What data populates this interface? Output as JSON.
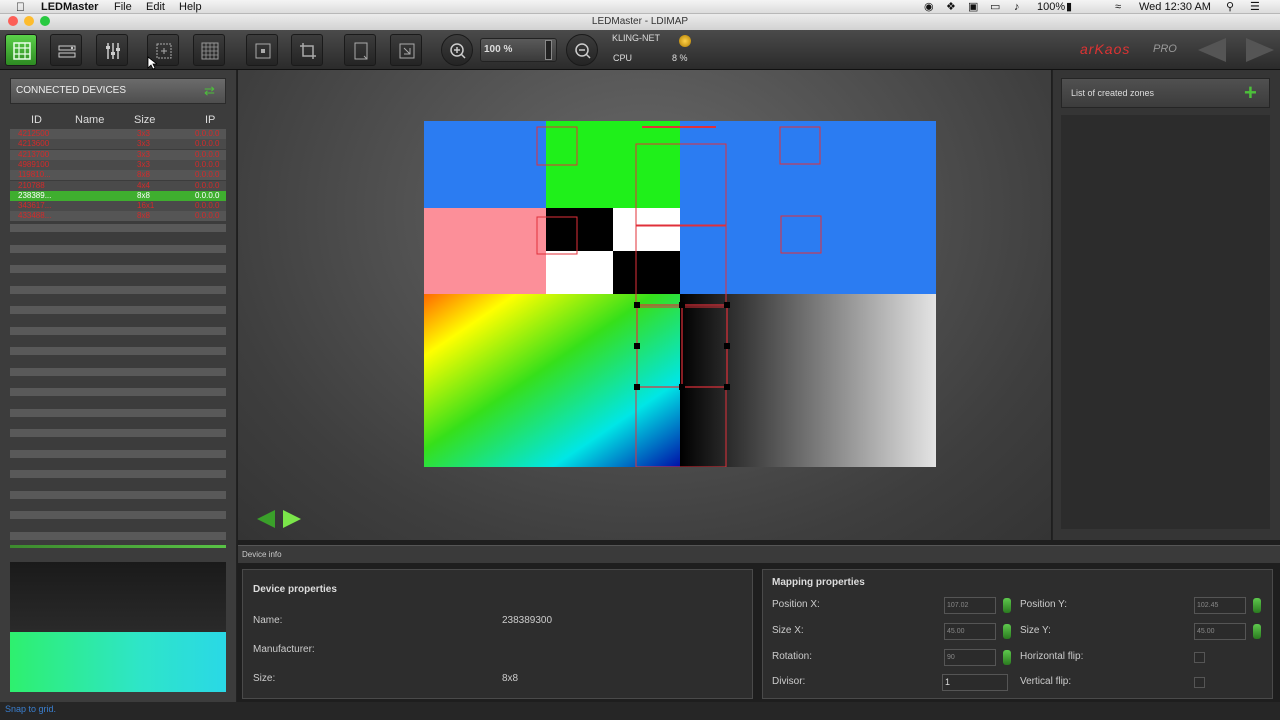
{
  "menubar": {
    "app_name": "LEDMaster",
    "menus": [
      "File",
      "Edit",
      "Help"
    ],
    "battery": "100%",
    "clock": "Wed 12:30 AM"
  },
  "window": {
    "title": "LEDMaster - LDIMAP"
  },
  "toolbar": {
    "zoom_value": "100 %",
    "protocol": "KLING-NET",
    "cpu_label": "CPU",
    "cpu_value": "8 %",
    "brand": "arKaos",
    "brand_suffix": "PRO"
  },
  "devices": {
    "title": "CONNECTED DEVICES",
    "columns": [
      "ID",
      "Name",
      "Size",
      "IP"
    ],
    "rows": [
      {
        "id": "4212500",
        "name": "",
        "size": "3x3",
        "ip": "0.0.0.0",
        "selected": false
      },
      {
        "id": "4213600",
        "name": "",
        "size": "3x3",
        "ip": "0.0.0.0",
        "selected": false
      },
      {
        "id": "4213700",
        "name": "",
        "size": "3x3",
        "ip": "0.0.0.0",
        "selected": false
      },
      {
        "id": "4989100",
        "name": "",
        "size": "3x3",
        "ip": "0.0.0.0",
        "selected": false
      },
      {
        "id": "119810...",
        "name": "",
        "size": "8x8",
        "ip": "0.0.0.0",
        "selected": false
      },
      {
        "id": "210788",
        "name": "",
        "size": "4x4",
        "ip": "0.0.0.0",
        "selected": false
      },
      {
        "id": "238389...",
        "name": "",
        "size": "8x8",
        "ip": "0.0.0.0",
        "selected": true
      },
      {
        "id": "343617...",
        "name": "",
        "size": "16x1",
        "ip": "0.0.0.0",
        "selected": false
      },
      {
        "id": "433488...",
        "name": "",
        "size": "8x8",
        "ip": "0.0.0.0",
        "selected": false
      }
    ]
  },
  "zones": {
    "title": "List of created zones"
  },
  "device_info": {
    "section_label": "Device info",
    "props_title": "Device properties",
    "name_label": "Name:",
    "name_value": "238389300",
    "manufacturer_label": "Manufacturer:",
    "manufacturer_value": "",
    "size_label": "Size:",
    "size_value": "8x8"
  },
  "mapping": {
    "title": "Mapping properties",
    "pos_x_label": "Position X:",
    "pos_x_value": "107.02",
    "pos_y_label": "Position Y:",
    "pos_y_value": "102.45",
    "size_x_label": "Size X:",
    "size_x_value": "45.00",
    "size_y_label": "Size Y:",
    "size_y_value": "45.00",
    "rotation_label": "Rotation:",
    "rotation_value": "90",
    "hflip_label": "Horizontal flip:",
    "divisor_label": "Divisor:",
    "divisor_value": "1",
    "vflip_label": "Vertical flip:"
  },
  "status": {
    "text": "Snap to grid."
  },
  "colors": {
    "accent_green": "#4cc13a",
    "device_red": "#d42a2a",
    "selected_row": "#3fae2f"
  }
}
